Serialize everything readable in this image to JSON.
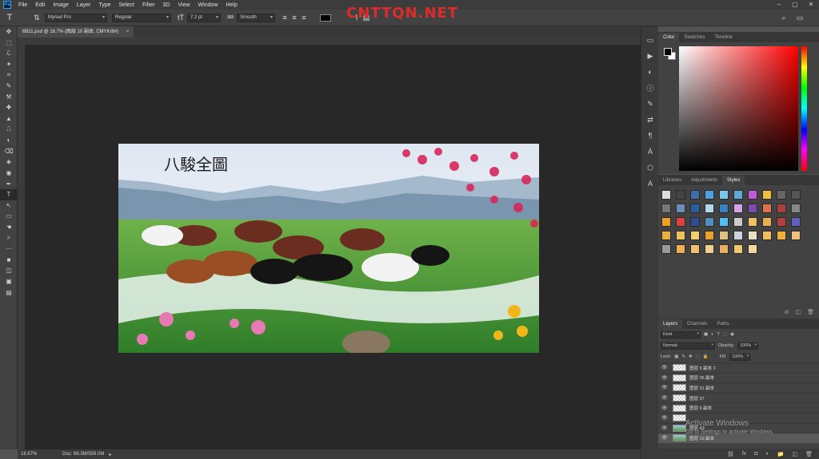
{
  "menu": [
    "File",
    "Edit",
    "Image",
    "Layer",
    "Type",
    "Select",
    "Filter",
    "3D",
    "View",
    "Window",
    "Help"
  ],
  "app_logo": "Ps",
  "window_controls": [
    "–",
    "▢",
    "✕"
  ],
  "options": {
    "tool_icon": "T",
    "font_family": "Myriad Pro",
    "font_style": "Regular",
    "font_size_icon": "tT",
    "font_size": "7.2 pt",
    "aa_icon": "aa",
    "antialias": "Smooth",
    "align": [
      "≡",
      "≡",
      "≡"
    ],
    "watermark": "CNTTQN.NET",
    "search_icon": "⌕",
    "workspace_icon": "▭"
  },
  "tools": [
    "✥",
    "⬚",
    "ℒ",
    "✦",
    "⌗",
    "✎",
    "⚒",
    "✚",
    "▲",
    "⎍",
    "◐",
    "⌫",
    "◈",
    "◉",
    "✒",
    "T",
    "↖",
    "▭",
    "☚",
    "⌕",
    "⋯",
    "■",
    "◫",
    "▣",
    "▤"
  ],
  "document": {
    "tab_title": "6B11.psd @ 16.7% (图层 10 副本, CMYK/8#)",
    "tab_close": "×"
  },
  "status": {
    "zoom": "16.67%",
    "doc_size": "Doc: 66.3M/559.0M",
    "arrow": "▸"
  },
  "artwork": {
    "calligraphy": "八駿全圖"
  },
  "strip1_icons": [
    "▭",
    "▶",
    "◐",
    "ⓘ",
    "✎",
    "⇄",
    "¶",
    "Ȧ",
    "⬡",
    "A"
  ],
  "strip2_icons": [
    "◨",
    "▦"
  ],
  "color_panel": {
    "tabs": [
      "Color",
      "Swatches",
      "Timeline"
    ],
    "fg_color": "#000000",
    "bg_color": "#ffffff"
  },
  "styles_panel": {
    "tabs": [
      "Libraries",
      "Adjustments",
      "Styles"
    ],
    "footer_icons": [
      "⊘",
      "◫",
      "🗑"
    ],
    "swatches": [
      "#ddd",
      "#444",
      "#3d6ea8",
      "#4ba3e3",
      "#7cc6e8",
      "#5fa9d9",
      "#c45bd6",
      "#f0c040",
      "#666",
      "#555",
      "#777",
      "#6a8fb8",
      "#2a5f9f",
      "#b0d9f0",
      "#3a7fc0",
      "#d4a3e3",
      "#7e4cb0",
      "#e07050",
      "#aa4040",
      "#888",
      "#f0a020",
      "#e04040",
      "#2c4e90",
      "#5090c0",
      "#50c0f0",
      "#ccc",
      "#f2c060",
      "#e8b050",
      "#b04040",
      "#6060c0",
      "#e8b040",
      "#f0c060",
      "#f0d070",
      "#e8a030",
      "#e0c080",
      "#d0d0e0",
      "#e8e0c0",
      "#f0c060",
      "#f0b040",
      "#f0c080",
      "#999",
      "#f0b050",
      "#f0c070",
      "#f0d090",
      "#e8b060",
      "#f0c870",
      "#f0d8a0"
    ]
  },
  "layers_panel": {
    "tabs": [
      "Layers",
      "Channels",
      "Paths"
    ],
    "filter_kind": "Kind",
    "filter_icons": [
      "▣",
      "◐",
      "T",
      "⬚",
      "◉"
    ],
    "blend_mode": "Normal",
    "opacity_label": "Opacity:",
    "opacity": "100%",
    "lock_label": "Lock:",
    "lock_icons": [
      "▦",
      "✎",
      "✥",
      "⬚",
      "🔒"
    ],
    "fill_label": "Fill:",
    "fill": "100%",
    "eye": "👁",
    "layers": [
      {
        "name": "图层 9 副本 2",
        "thumb": "checker"
      },
      {
        "name": "图层 36 副本",
        "thumb": "checker"
      },
      {
        "name": "图层 31 副本",
        "thumb": "checker"
      },
      {
        "name": "图层 37",
        "thumb": "checker"
      },
      {
        "name": "图层 9 副本",
        "thumb": "checker"
      },
      {
        "name": "",
        "thumb": "checker"
      },
      {
        "name": "图层 43",
        "thumb": "img"
      },
      {
        "name": "图层 10 副本",
        "thumb": "img"
      }
    ],
    "footer_icons": [
      "⛓",
      "fx",
      "◘",
      "◐",
      "📁",
      "◫",
      "🗑"
    ]
  },
  "os_watermark": {
    "line1": "Activate Windows",
    "line2": "Go to Settings to activate Windows."
  }
}
